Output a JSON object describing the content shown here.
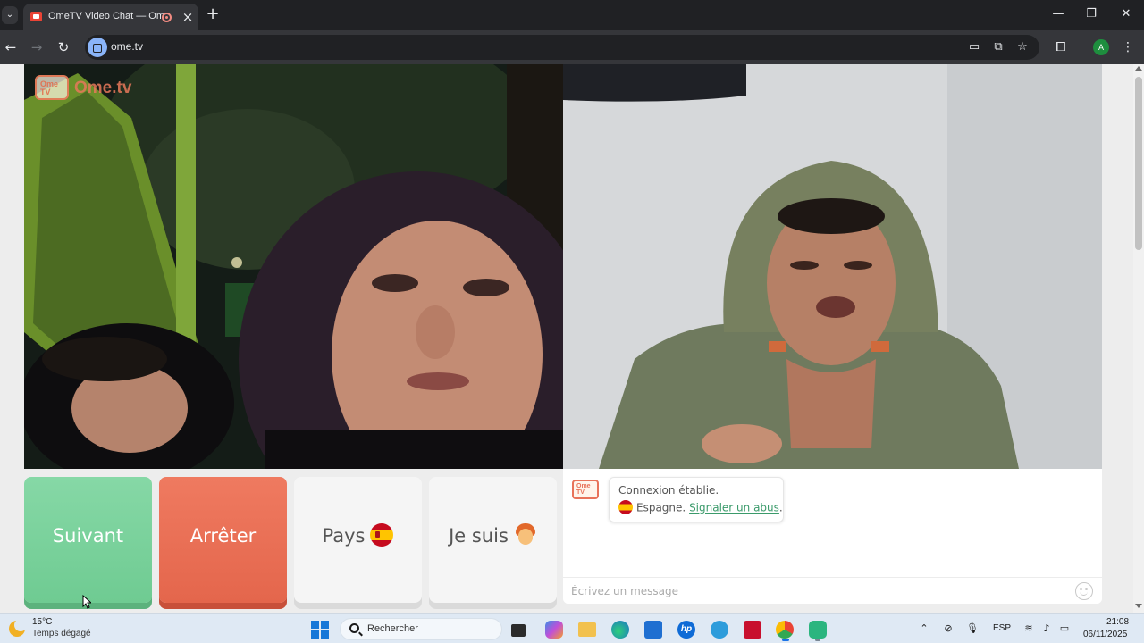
{
  "browser": {
    "tab_title": "OmeTV Video Chat — Ome",
    "url": "ome.tv",
    "profile_initial": "A"
  },
  "page": {
    "logo": {
      "tv_text": "Ome\nTV",
      "text": "Ome.tv"
    },
    "buttons": {
      "next": "Suivant",
      "stop": "Arrêter",
      "country": "Pays",
      "gender": "Je suis"
    },
    "chat": {
      "logo_text": "Ome\nTV",
      "status": "Connexion établie.",
      "country": "Espagne.",
      "report": "Signaler un abus",
      "period": ".",
      "input_placeholder": "Écrivez un message"
    }
  },
  "taskbar": {
    "weather_temp": "15°C",
    "weather_desc": "Temps dégagé",
    "search_placeholder": "Rechercher",
    "language": "ESP",
    "time": "21:08",
    "date": "06/11/2025"
  },
  "colors": {
    "next_button": "#6fcb92",
    "stop_button": "#e4664c",
    "brand_accent": "#e8735a",
    "link": "#3a9a6a"
  },
  "icons": {
    "country_flag": "spain-flag-icon",
    "gender_avatar": "boy-face-icon",
    "emoji": "smiley-icon"
  }
}
